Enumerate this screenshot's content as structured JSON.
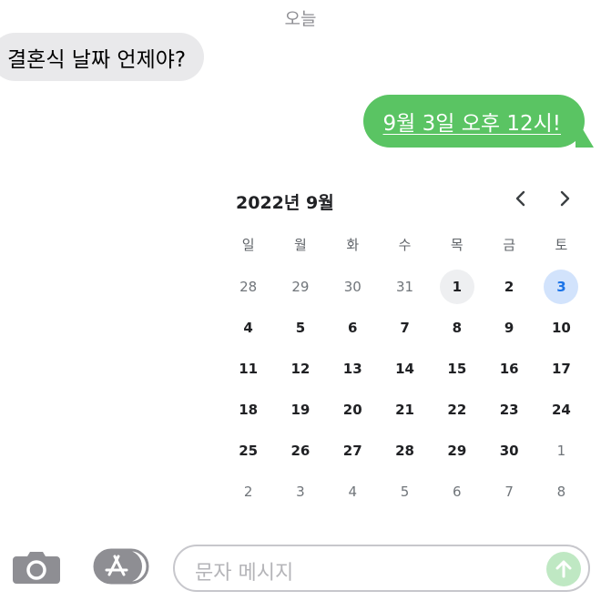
{
  "header": {
    "date_label": "오늘"
  },
  "messages": [
    {
      "direction": "incoming",
      "text": "결혼식 날짜 언제야?"
    },
    {
      "direction": "outgoing",
      "text": "9월 3일 오후 12시!",
      "color": "#5ac463"
    }
  ],
  "calendar": {
    "title": "2022년 9월",
    "prev_icon": "chevron-left-icon",
    "next_icon": "chevron-right-icon",
    "weekdays": [
      "일",
      "월",
      "화",
      "수",
      "목",
      "금",
      "토"
    ],
    "weeks": [
      [
        "28",
        "29",
        "30",
        "31",
        "1",
        "2",
        "3"
      ],
      [
        "4",
        "5",
        "6",
        "7",
        "8",
        "9",
        "10"
      ],
      [
        "11",
        "12",
        "13",
        "14",
        "15",
        "16",
        "17"
      ],
      [
        "18",
        "19",
        "20",
        "21",
        "22",
        "23",
        "24"
      ],
      [
        "25",
        "26",
        "27",
        "28",
        "29",
        "30",
        "1"
      ],
      [
        "2",
        "3",
        "4",
        "5",
        "6",
        "7",
        "8"
      ]
    ],
    "today": "1",
    "selected": "3",
    "selected_color": "#d2e3fc"
  },
  "composer": {
    "camera_icon": "camera-icon",
    "apps_icon": "app-store-icon",
    "placeholder": "문자 메시지",
    "send_icon": "send-arrow-icon"
  }
}
